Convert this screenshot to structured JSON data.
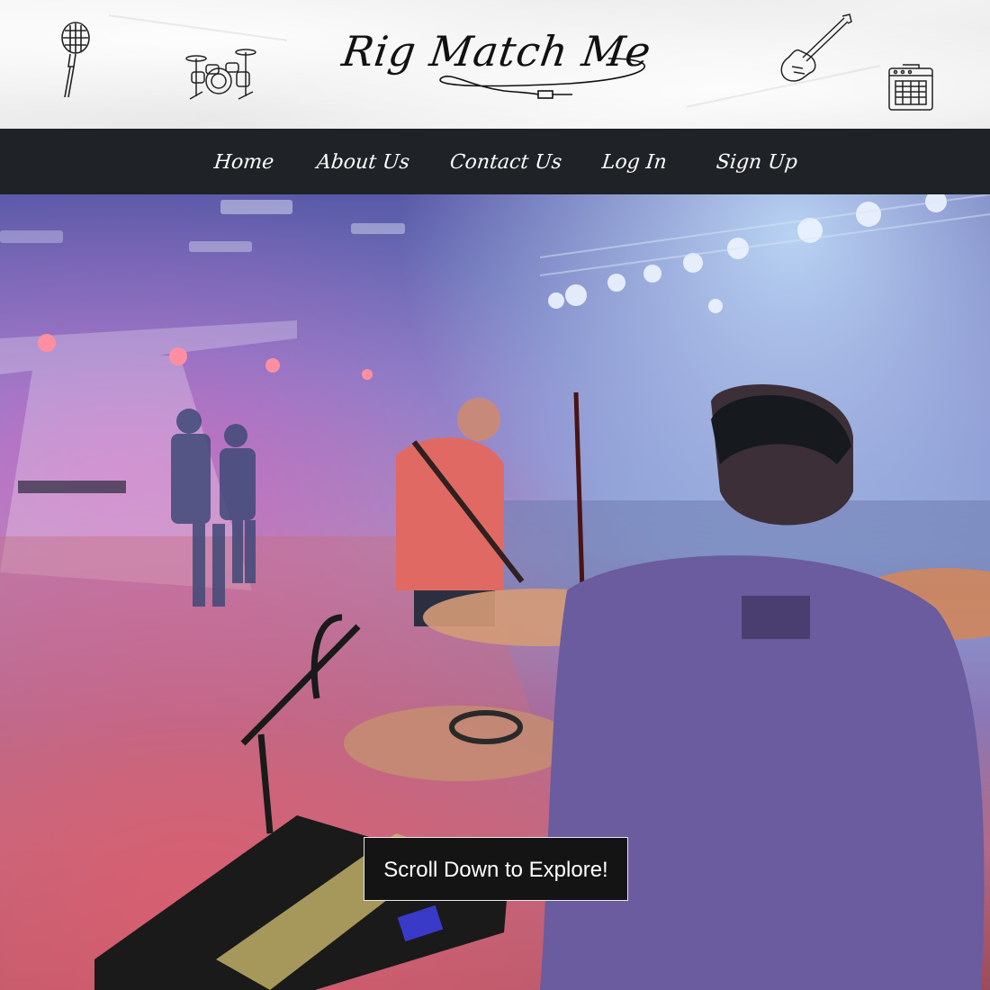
{
  "brand": {
    "logo_text": "Rig Match Me"
  },
  "nav": {
    "items": [
      {
        "label": "Home"
      },
      {
        "label": "About Us"
      },
      {
        "label": "Contact Us"
      },
      {
        "label": "Log In"
      },
      {
        "label": "Sign Up"
      }
    ]
  },
  "hero": {
    "cta_label": "Scroll Down to Explore!",
    "image_description_icon": "concert-stage-photo"
  },
  "icons": {
    "microphone": "microphone-icon",
    "drum_kit": "drum-kit-icon",
    "guitar": "electric-guitar-icon",
    "amplifier": "amplifier-icon"
  },
  "colors": {
    "navbar_bg": "#1f2226",
    "nav_text": "#ffffff",
    "cta_bg": "#141414",
    "cta_border": "#e8e8e8"
  }
}
